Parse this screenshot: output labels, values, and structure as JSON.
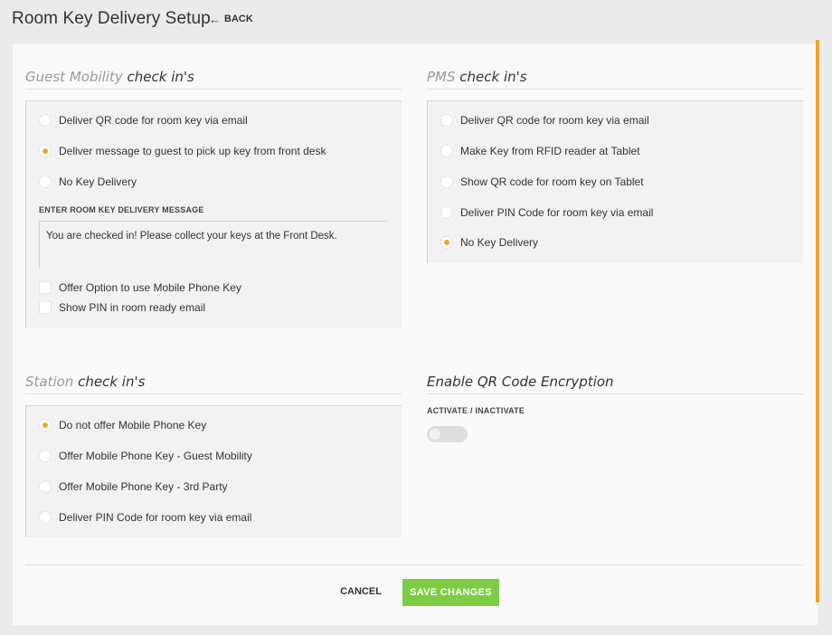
{
  "header": {
    "title": "Room Key Delivery Setup",
    "back_label": "BACK"
  },
  "guest_mobility": {
    "title_prefix": "Guest Mobility",
    "title_suffix": "check in's",
    "options": [
      {
        "label": "Deliver QR code for room key via email",
        "selected": false
      },
      {
        "label": "Deliver message to guest to pick up key from front desk",
        "selected": true
      },
      {
        "label": "No Key Delivery",
        "selected": false
      }
    ],
    "message_label": "ENTER ROOM KEY DELIVERY MESSAGE",
    "message_value": "You are checked in! Please collect your keys at the Front Desk.",
    "checkboxes": [
      {
        "label": "Offer Option to use Mobile Phone Key",
        "checked": false
      },
      {
        "label": "Show PIN in room ready email",
        "checked": false
      }
    ]
  },
  "pms": {
    "title_prefix": "PMS",
    "title_suffix": "check in's",
    "options": [
      {
        "label": "Deliver QR code for room key via email",
        "selected": false
      },
      {
        "label": "Make Key from RFID reader at Tablet",
        "selected": false
      },
      {
        "label": "Show QR code for room key on Tablet",
        "selected": false
      },
      {
        "label": "Deliver PIN Code for room key via email",
        "selected": false
      },
      {
        "label": "No Key Delivery",
        "selected": true
      }
    ]
  },
  "station": {
    "title_prefix": "Station",
    "title_suffix": "check in's",
    "options": [
      {
        "label": "Do not offer Mobile Phone Key",
        "selected": true
      },
      {
        "label": "Offer Mobile Phone Key - Guest Mobility",
        "selected": false
      },
      {
        "label": "Offer Mobile Phone Key - 3rd Party",
        "selected": false
      },
      {
        "label": "Deliver PIN Code for room key via email",
        "selected": false
      }
    ]
  },
  "qr_encryption": {
    "title": "Enable QR Code Encryption",
    "toggle_label": "ACTIVATE / INACTIVATE",
    "active": false
  },
  "footer": {
    "cancel_label": "CANCEL",
    "save_label": "SAVE CHANGES"
  },
  "colors": {
    "accent": "#f0a32c",
    "save_button": "#7ccd43"
  }
}
